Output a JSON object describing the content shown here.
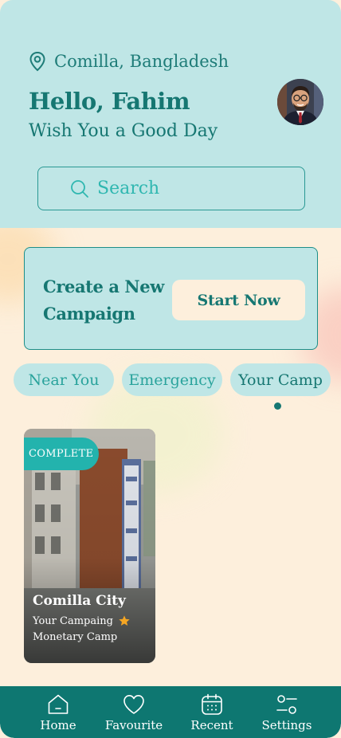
{
  "header": {
    "location": "Comilla, Bangladesh",
    "greeting": "Hello, Fahim",
    "wish": "Wish You a Good Day",
    "location_icon": "map-pin-icon",
    "avatar": "user-avatar"
  },
  "search": {
    "placeholder": "Search",
    "icon": "search-icon"
  },
  "campaign_banner": {
    "title": "Create a New Campaign",
    "cta": "Start Now"
  },
  "tabs": [
    {
      "label": "Near You"
    },
    {
      "label": "Emergency"
    },
    {
      "label": "Your Camp"
    }
  ],
  "selected_tab": 2,
  "cards": [
    {
      "status": "COMPLETE",
      "title": "Comilla City",
      "subtitle": "Your Campaing",
      "type": "Monetary Camp",
      "star_icon": "star-icon"
    }
  ],
  "nav": [
    {
      "label": "Home",
      "icon": "home-icon"
    },
    {
      "label": "Favourite",
      "icon": "heart-icon"
    },
    {
      "label": "Recent",
      "icon": "calendar-icon"
    },
    {
      "label": "Settings",
      "icon": "settings-icon"
    }
  ],
  "colors": {
    "primary": "#167772",
    "header_bg": "#bfe6e6",
    "page_bg": "#fdefdc",
    "accent": "#23b3ad",
    "nav_bg": "#0e7771",
    "star": "#f5a623"
  }
}
